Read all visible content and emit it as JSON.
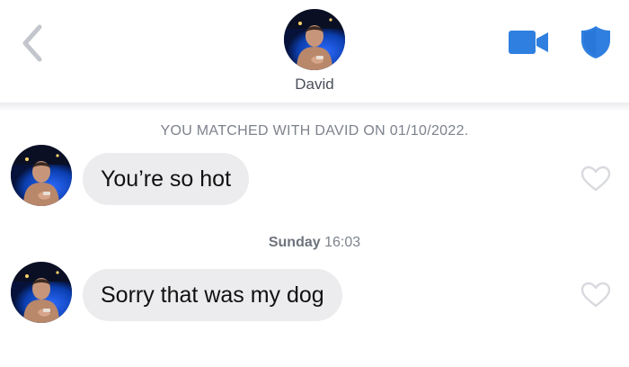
{
  "header": {
    "contact_name": "David",
    "back_icon": "chevron-left-icon",
    "video_icon": "video-camera-icon",
    "safety_icon": "shield-icon",
    "accent_color": "#2f7fe0"
  },
  "match_banner": "YOU MATCHED WITH DAVID ON 01/10/2022.",
  "messages": [
    {
      "text": "You’re so hot",
      "liked": false
    },
    {
      "text": "Sorry that was my dog",
      "liked": false
    }
  ],
  "divider": {
    "day": "Sunday",
    "time": "16:03"
  }
}
